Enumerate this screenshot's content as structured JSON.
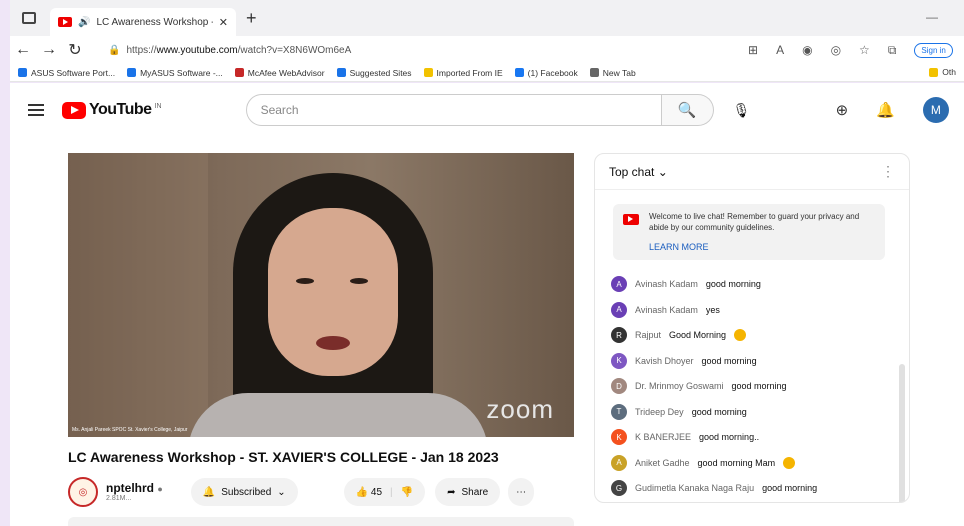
{
  "browser": {
    "tab_title": "LC Awareness Workshop - ...",
    "url_prefix": "https://",
    "url_host": "www.youtube.com",
    "url_path": "/watch?v=X8N6WOm6eA",
    "signin_label": "Sign in",
    "bookmarks": [
      {
        "label": "ASUS Software Port...",
        "color": "#1a73e8"
      },
      {
        "label": "MyASUS Software -...",
        "color": "#1a73e8"
      },
      {
        "label": "McAfee WebAdvisor",
        "color": "#c62828"
      },
      {
        "label": "Suggested Sites",
        "color": "#1a73e8"
      },
      {
        "label": "Imported From IE",
        "color": "#f2c200"
      },
      {
        "label": "(1) Facebook",
        "color": "#1877f2"
      },
      {
        "label": "New Tab",
        "color": "#666666"
      }
    ],
    "bookmark_last": "Oth"
  },
  "youtube": {
    "logo_text": "YouTube",
    "country": "IN",
    "search_placeholder": "Search",
    "avatar_letter": "M"
  },
  "video": {
    "zoom_label": "zoom",
    "caption": "Ms. Anjali Pareek SPOC St. Xavier's College, Jaipur",
    "title": "LC Awareness Workshop - ST. XAVIER'S COLLEGE - Jan 18 2023",
    "channel": "nptelhrd",
    "subs": "2.81M...",
    "subscribed_label": "Subscribed",
    "likes": "45",
    "share_label": "Share"
  },
  "chat": {
    "header": "Top chat",
    "welcome": "Welcome to live chat! Remember to guard your privacy and abide by our community guidelines.",
    "learn_more": "LEARN MORE",
    "messages": [
      {
        "author": "Avinash Kadam",
        "text": "good morning",
        "avatar": "A",
        "color": "#6a3fb5",
        "emoji": false
      },
      {
        "author": "Avinash Kadam",
        "text": "yes",
        "avatar": "A",
        "color": "#6a3fb5",
        "emoji": false
      },
      {
        "author": "Rajput",
        "text": "Good Morning",
        "avatar": "R",
        "color": "#333333",
        "emoji": true
      },
      {
        "author": "Kavish Dhoyer",
        "text": "good morning",
        "avatar": "K",
        "color": "#7e57c2",
        "emoji": false
      },
      {
        "author": "Dr. Mrinmoy Goswami",
        "text": "good morning",
        "avatar": "D",
        "color": "#a1887f",
        "emoji": false
      },
      {
        "author": "Trideep Dey",
        "text": "good morning",
        "avatar": "T",
        "color": "#5d6d7e",
        "emoji": false
      },
      {
        "author": "K BANERJEE",
        "text": "good morning..",
        "avatar": "K",
        "color": "#f4511e",
        "emoji": false
      },
      {
        "author": "Aniket Gadhe",
        "text": "good morning Mam",
        "avatar": "A",
        "color": "#c9a227",
        "emoji": true
      },
      {
        "author": "Gudimetla Kanaka Naga Raju",
        "text": "good morning",
        "avatar": "G",
        "color": "#444444",
        "emoji": false
      }
    ]
  }
}
